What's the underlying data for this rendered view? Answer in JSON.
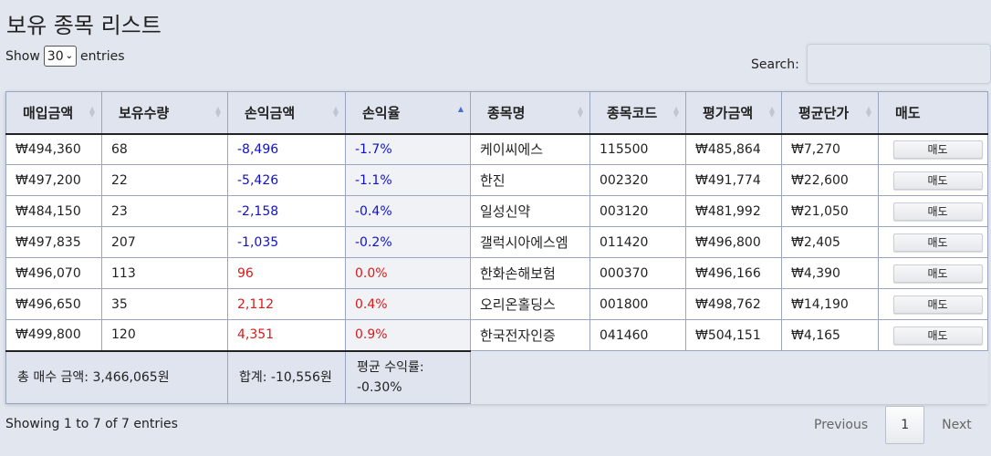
{
  "title": "보유 종목 리스트",
  "length": {
    "show_label": "Show",
    "value": "30",
    "entries_label": "entries"
  },
  "search": {
    "label": "Search:",
    "value": ""
  },
  "columns": [
    "매입금액",
    "보유수량",
    "손익금액",
    "손익율",
    "종목명",
    "종목코드",
    "평가금액",
    "평균단가",
    "매도"
  ],
  "rows": [
    {
      "buy": "₩494,360",
      "qty": "68",
      "pl": "-8,496",
      "rate": "-1.7%",
      "name": "케이씨에스",
      "code": "115500",
      "eval": "₩485,864",
      "avg": "₩7,270",
      "sell": "매도"
    },
    {
      "buy": "₩497,200",
      "qty": "22",
      "pl": "-5,426",
      "rate": "-1.1%",
      "name": "한진",
      "code": "002320",
      "eval": "₩491,774",
      "avg": "₩22,600",
      "sell": "매도"
    },
    {
      "buy": "₩484,150",
      "qty": "23",
      "pl": "-2,158",
      "rate": "-0.4%",
      "name": "일성신약",
      "code": "003120",
      "eval": "₩481,992",
      "avg": "₩21,050",
      "sell": "매도"
    },
    {
      "buy": "₩497,835",
      "qty": "207",
      "pl": "-1,035",
      "rate": "-0.2%",
      "name": "갤럭시아에스엠",
      "code": "011420",
      "eval": "₩496,800",
      "avg": "₩2,405",
      "sell": "매도"
    },
    {
      "buy": "₩496,070",
      "qty": "113",
      "pl": "96",
      "rate": "0.0%",
      "name": "한화손해보험",
      "code": "000370",
      "eval": "₩496,166",
      "avg": "₩4,390",
      "sell": "매도"
    },
    {
      "buy": "₩496,650",
      "qty": "35",
      "pl": "2,112",
      "rate": "0.4%",
      "name": "오리온홀딩스",
      "code": "001800",
      "eval": "₩498,762",
      "avg": "₩14,190",
      "sell": "매도"
    },
    {
      "buy": "₩499,800",
      "qty": "120",
      "pl": "4,351",
      "rate": "0.9%",
      "name": "한국전자인증",
      "code": "041460",
      "eval": "₩504,151",
      "avg": "₩4,165",
      "sell": "매도"
    }
  ],
  "footer": {
    "total_buy": "총 매수 금액: 3,466,065원",
    "total_pl": "합계: -10,556원",
    "avg_rate": "평균 수익률: -0.30%"
  },
  "info": "Showing 1 to 7 of 7 entries",
  "pagination": {
    "previous": "Previous",
    "page": "1",
    "next": "Next"
  },
  "colors": {
    "negative": "#1212c8",
    "positive": "#d81b1b",
    "sort_active": "#4a6fd1"
  }
}
